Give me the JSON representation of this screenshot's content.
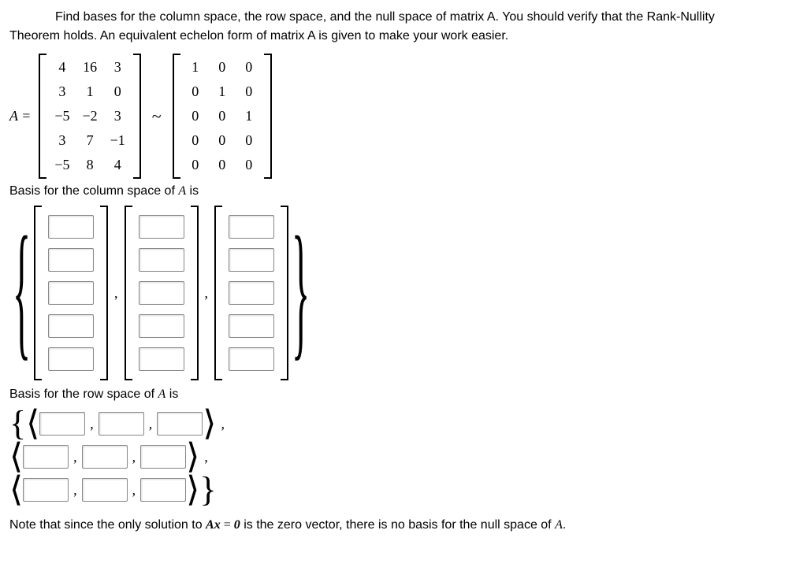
{
  "intro": {
    "line1": "Find bases for the column space, the row space, and the null space of matrix A. You should verify that the Rank-Nullity",
    "line2": "Theorem holds. An equivalent echelon form of matrix A is given to make your work easier."
  },
  "equation": {
    "lhs": "A =",
    "tilde": "~",
    "matrixA": [
      [
        "4",
        "16",
        "3"
      ],
      [
        "3",
        "1",
        "0"
      ],
      [
        "−5",
        "−2",
        "3"
      ],
      [
        "3",
        "7",
        "−1"
      ],
      [
        "−5",
        "8",
        "4"
      ]
    ],
    "matrixR": [
      [
        "1",
        "0",
        "0"
      ],
      [
        "0",
        "1",
        "0"
      ],
      [
        "0",
        "0",
        "1"
      ],
      [
        "0",
        "0",
        "0"
      ],
      [
        "0",
        "0",
        "0"
      ]
    ]
  },
  "labels": {
    "colspace_pre": "Basis for the column space of ",
    "colspace_A": "A",
    "colspace_post": " is",
    "rowspace_pre": "Basis for the row space of ",
    "rowspace_A": "A",
    "rowspace_post": " is"
  },
  "symbols": {
    "lbrace": "{",
    "rbrace": "}",
    "langle": "⟨",
    "rangle": "⟩",
    "comma": ","
  },
  "note": {
    "pre": "Note that since the only solution to ",
    "ax": "Ax",
    "eq": " = ",
    "zero": "0",
    "post": " is the zero vector, there is no basis for the null space of ",
    "A": "A",
    "period": "."
  }
}
